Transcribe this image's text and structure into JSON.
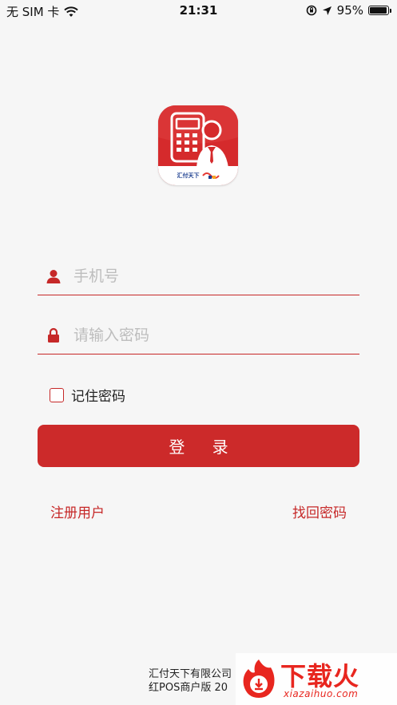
{
  "status_bar": {
    "carrier": "无 SIM 卡",
    "time": "21:31",
    "battery": "95%",
    "battery_level": 0.95
  },
  "logo": {
    "brand_text": "汇付天下"
  },
  "form": {
    "phone_placeholder": "手机号",
    "password_placeholder": "请输入密码",
    "remember_label": "记住密码",
    "login_label": "登 录"
  },
  "links": {
    "register": "注册用户",
    "forgot": "找回密码"
  },
  "footer": {
    "line1": "汇付天下有限公司",
    "line2": "红POS商户版 20"
  },
  "watermark": {
    "title": "下载火",
    "subtitle": "xiazaihuo.com"
  },
  "colors": {
    "accent": "#cc2a2a",
    "background": "#f6f6f6"
  }
}
